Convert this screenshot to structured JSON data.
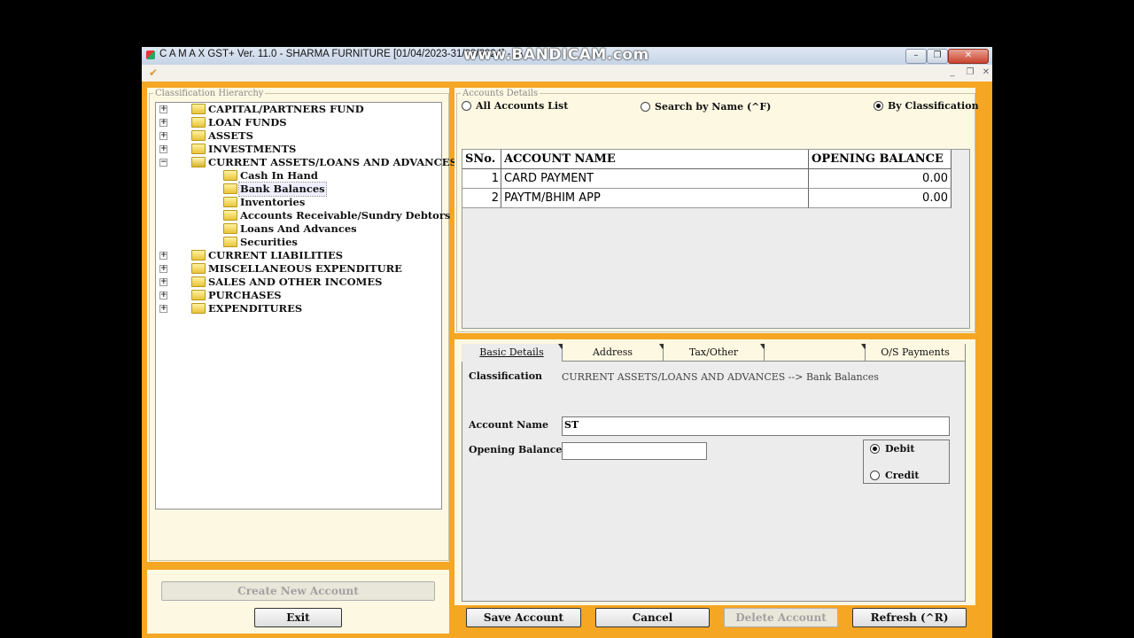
{
  "window": {
    "title": "C A  M A X GST+ Ver. 11.0 - SHARMA FURNITURE [01/04/2023-31/03/2024] - [A",
    "watermark": "www.BANDICAM.com",
    "controls": {
      "minimize": "–",
      "restore": "❐",
      "close": "✕"
    },
    "mdi_controls": {
      "minimize": "_",
      "restore": "❐",
      "close": "✕"
    }
  },
  "hierarchy": {
    "legend": "Classification Hierarchy",
    "nodes": [
      {
        "label": "CAPITAL/PARTNERS FUND",
        "expander": "+"
      },
      {
        "label": "LOAN FUNDS",
        "expander": "+"
      },
      {
        "label": "ASSETS",
        "expander": "+"
      },
      {
        "label": "INVESTMENTS",
        "expander": "+"
      },
      {
        "label": "CURRENT ASSETS/LOANS AND ADVANCES",
        "expander": "−"
      },
      {
        "label": "Cash In Hand"
      },
      {
        "label": "Bank Balances"
      },
      {
        "label": "Inventories"
      },
      {
        "label": "Accounts Receivable/Sundry Debtors"
      },
      {
        "label": "Loans And Advances"
      },
      {
        "label": "Securities"
      },
      {
        "label": "CURRENT LIABILITIES",
        "expander": "+"
      },
      {
        "label": "MISCELLANEOUS EXPENDITURE",
        "expander": "+"
      },
      {
        "label": "SALES AND OTHER INCOMES",
        "expander": "+"
      },
      {
        "label": "PURCHASES",
        "expander": "+"
      },
      {
        "label": "EXPENDITURES",
        "expander": "+"
      }
    ]
  },
  "accounts": {
    "legend": "Accounts Details",
    "radios": [
      {
        "label": "All Accounts List",
        "selected": false
      },
      {
        "label": "Search by Name (^F)",
        "selected": false
      },
      {
        "label": "By Classification",
        "selected": true
      }
    ],
    "columns": [
      "SNo.",
      "ACCOUNT NAME",
      "OPENING BALANCE"
    ],
    "rows": [
      {
        "sno": "1",
        "name": "CARD PAYMENT",
        "balance": "0.00"
      },
      {
        "sno": "2",
        "name": "PAYTM/BHIM APP",
        "balance": "0.00"
      }
    ]
  },
  "tabs": [
    "Basic Details",
    "Address",
    "Tax/Other",
    "",
    "O/S Payments"
  ],
  "form": {
    "classification_label": "Classification",
    "classification_value": "CURRENT ASSETS/LOANS AND ADVANCES --> Bank Balances",
    "account_name_label": "Account Name",
    "account_name_value": "ST",
    "opening_balance_label": "Opening Balance",
    "opening_balance_value": "",
    "debit_label": "Debit",
    "credit_label": "Credit",
    "balance_type": "Debit"
  },
  "buttons": {
    "create": "Create New Account",
    "exit": "Exit",
    "save": "Save Account",
    "cancel": "Cancel",
    "delete": "Delete Account",
    "refresh": "Refresh (^R)"
  }
}
